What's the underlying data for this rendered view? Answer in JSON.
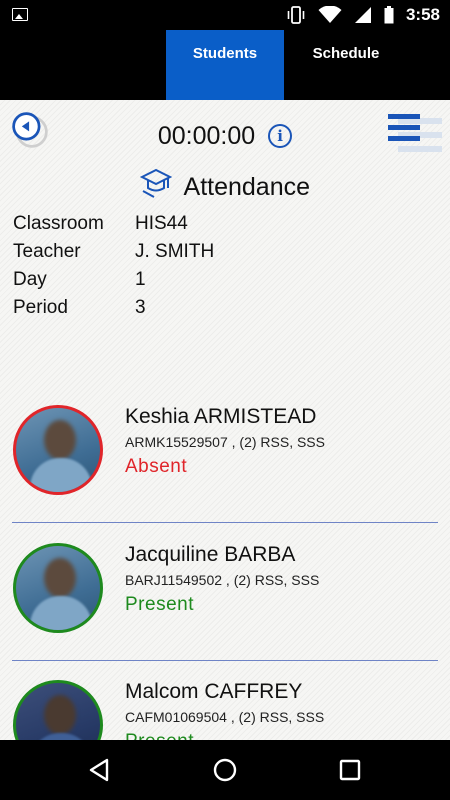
{
  "status_bar": {
    "time": "3:58"
  },
  "tabs": [
    {
      "label": "Students"
    },
    {
      "label": "Schedule"
    }
  ],
  "header": {
    "timer": "00:00:00",
    "info_glyph": "i"
  },
  "attendance": {
    "title": "Attendance",
    "info": [
      {
        "label": "Classroom",
        "value": "HIS44"
      },
      {
        "label": "Teacher",
        "value": "J. SMITH"
      },
      {
        "label": "Day",
        "value": "1"
      },
      {
        "label": "Period",
        "value": "3"
      }
    ]
  },
  "students": [
    {
      "name": "Keshia ARMISTEAD",
      "id_line": "ARMK15529507 , (2) RSS, SSS",
      "status": "Absent",
      "status_color": "#e0252a"
    },
    {
      "name": "Jacquiline BARBA",
      "id_line": "BARJ11549502 , (2) RSS, SSS",
      "status": "Present",
      "status_color": "#1e8a1e"
    },
    {
      "name": "Malcom CAFFREY",
      "id_line": "CAFM01069504 , (2) RSS, SSS",
      "status": "Present",
      "status_color": "#1e8a1e"
    }
  ],
  "colors": {
    "accent": "#0a5ec8",
    "absent": "#e0252a",
    "present": "#1e8a1e"
  }
}
